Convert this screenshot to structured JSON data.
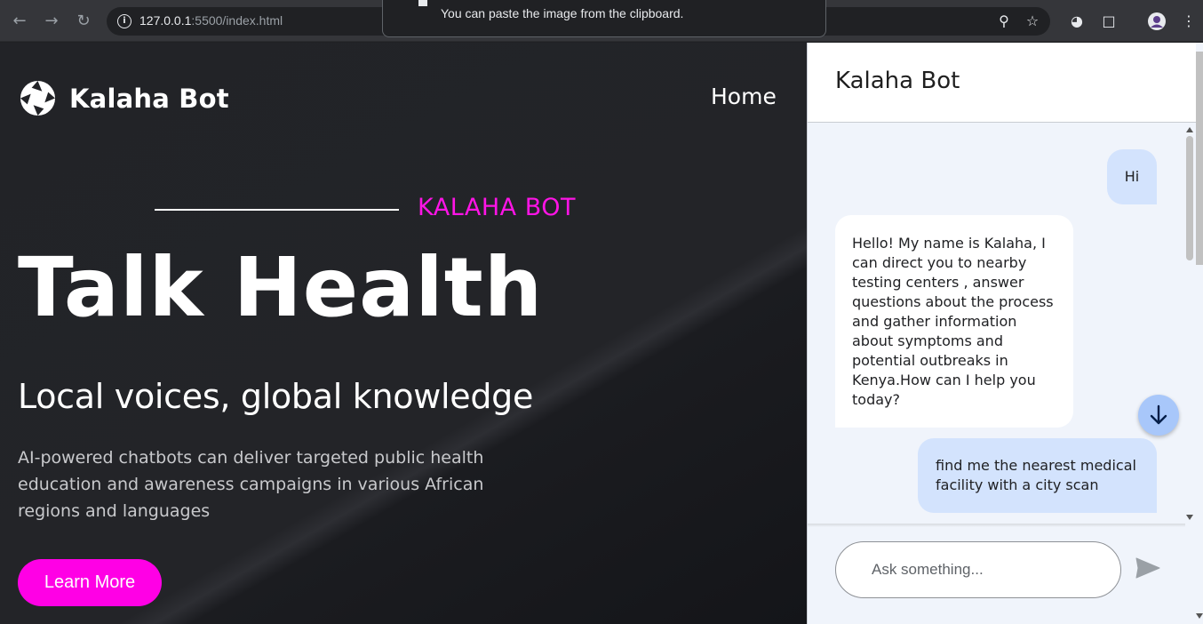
{
  "browser": {
    "url_host": "127.0.0.1",
    "url_rest": ":5500/index.html",
    "toast_text": "You can paste the image from the clipboard.",
    "icons": [
      "back-icon",
      "forward-icon",
      "reload-icon",
      "info-icon",
      "zoom-icon",
      "star-icon",
      "extension-icon",
      "puzzle-icon",
      "avatar",
      "more-icon"
    ]
  },
  "hero": {
    "brand": "Kalaha Bot",
    "nav_home": "Home",
    "eyebrow": "KALAHA BOT",
    "headline": "Talk Health",
    "subhead": "Local voices, global knowledge",
    "paragraph": "AI-powered chatbots can deliver targeted public health education and awareness campaigns in various African regions and languages",
    "cta": "Learn More",
    "accent_color": "#ff00e5"
  },
  "chat": {
    "title": "Kalaha Bot",
    "messages": [
      {
        "role": "user",
        "text": "Hi"
      },
      {
        "role": "bot",
        "text": "Hello! My name is Kalaha, I can direct you to nearby testing centers , answer questions about the process and gather information about symptoms and potential outbreaks in Kenya.How can I help you today?"
      },
      {
        "role": "user",
        "text": "find me the nearest medical facility with a city scan"
      }
    ],
    "input_placeholder": "Ask something...",
    "user_bubble_color": "#d3e3fd"
  }
}
